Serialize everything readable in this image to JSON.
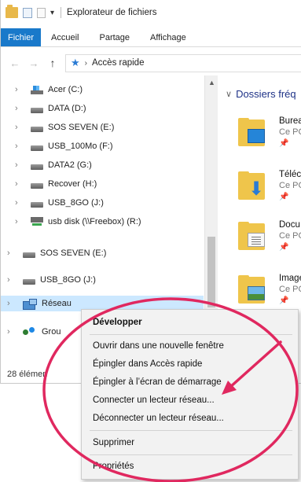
{
  "window": {
    "title": "Explorateur de fichiers",
    "quick_access_dropdown": "▾"
  },
  "ribbon": {
    "tabs": [
      {
        "label": "Fichier",
        "active": true
      },
      {
        "label": "Accueil",
        "active": false
      },
      {
        "label": "Partage",
        "active": false
      },
      {
        "label": "Affichage",
        "active": false
      }
    ]
  },
  "address_bar": {
    "back": "←",
    "forward": "→",
    "up": "↑",
    "breadcrumb_separator": "›",
    "path": "Accès rapide"
  },
  "nav_pane": {
    "items": [
      {
        "label": "Acer (C:)",
        "icon": "os-drive-icon"
      },
      {
        "label": "DATA (D:)",
        "icon": "drive-icon"
      },
      {
        "label": "SOS SEVEN (E:)",
        "icon": "drive-icon"
      },
      {
        "label": "USB_100Mo (F:)",
        "icon": "drive-icon"
      },
      {
        "label": "DATA2 (G:)",
        "icon": "drive-icon"
      },
      {
        "label": "Recover (H:)",
        "icon": "drive-icon"
      },
      {
        "label": "USB_8GO (J:)",
        "icon": "drive-icon"
      },
      {
        "label": "usb disk (\\\\Freebox) (R:)",
        "icon": "network-drive-icon"
      },
      {
        "label": "SOS SEVEN (E:)",
        "icon": "drive-icon"
      },
      {
        "label": "USB_8GO (J:)",
        "icon": "drive-icon"
      },
      {
        "label": "Réseau",
        "icon": "network-icon",
        "selected": true
      },
      {
        "label": "Grou",
        "icon": "homegroup-icon"
      }
    ]
  },
  "content": {
    "section_title": "Dossiers fréq",
    "folders": [
      {
        "name": "Burea",
        "location": "Ce PC",
        "badge": "desktop"
      },
      {
        "name": "Téléc",
        "location": "Ce PC",
        "badge": "download"
      },
      {
        "name": "Docu",
        "location": "Ce PC",
        "badge": "document"
      },
      {
        "name": "Image",
        "location": "Ce PC",
        "badge": "image"
      }
    ]
  },
  "status_bar": {
    "item_count": "28 élémen"
  },
  "context_menu": {
    "items": [
      {
        "label": "Développer",
        "bold": true
      },
      {
        "label": "Ouvrir dans une nouvelle fenêtre"
      },
      {
        "label": "Épingler dans Accès rapide"
      },
      {
        "label": "Épingler à l’écran de démarrage"
      },
      {
        "label": "Connecter un lecteur réseau...",
        "highlighted_by_annotation": true
      },
      {
        "label": "Déconnecter un lecteur réseau..."
      },
      {
        "label": "Supprimer"
      },
      {
        "label": "Propriétés"
      }
    ]
  },
  "annotation": {
    "color": "#e0285f"
  }
}
